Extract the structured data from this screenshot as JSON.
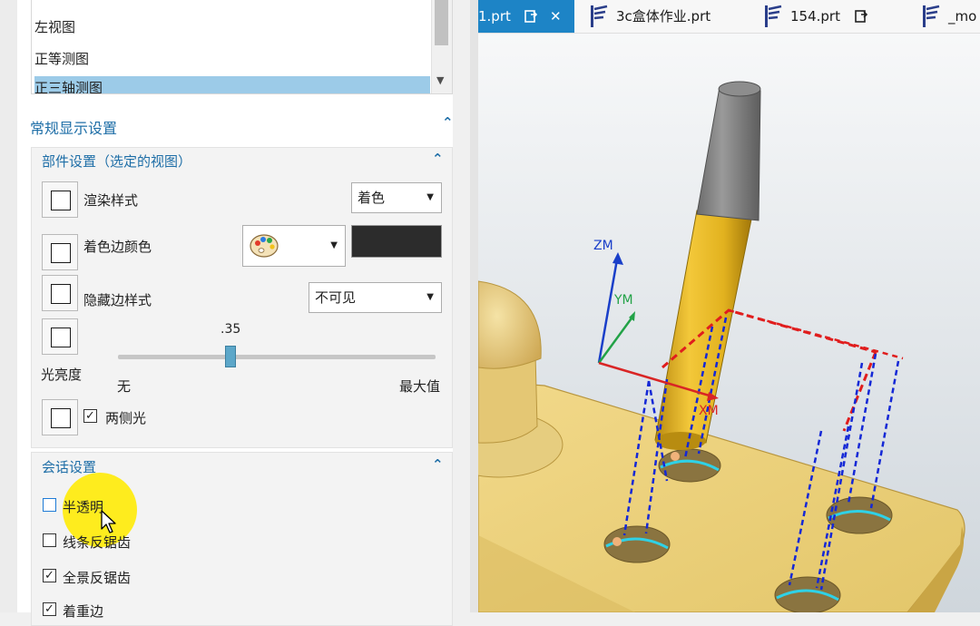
{
  "view_list": {
    "items": [
      "左视图",
      "正等测图",
      "正三轴测图"
    ]
  },
  "general_display": {
    "title": "常规显示设置",
    "part_settings": {
      "title": "部件设置（选定的视图）",
      "render_style": {
        "label": "渲染样式",
        "value": "着色"
      },
      "shaded_edge_color": {
        "label": "着色边颜色",
        "color": "#2c2c2c"
      },
      "hidden_edge_style": {
        "label": "隐藏边样式",
        "value": "不可见"
      },
      "light_brightness": {
        "label": "光亮度",
        "value": ".35",
        "fraction": 0.35,
        "min_label": "无",
        "max_label": "最大值"
      },
      "two_sided_light": {
        "label": "两侧光",
        "checked": true
      }
    },
    "session_settings": {
      "title": "会话设置",
      "options": [
        {
          "label": "半透明",
          "checked": false
        },
        {
          "label": "线条反锯齿",
          "checked": false
        },
        {
          "label": "全景反锯齿",
          "checked": true
        },
        {
          "label": "着重边",
          "checked": true
        }
      ]
    }
  },
  "tabs": [
    {
      "label": "1.prt"
    },
    {
      "label": "3c盒体作业.prt"
    },
    {
      "label": "154.prt"
    },
    {
      "label": "_mo"
    }
  ],
  "axes": {
    "x": "XM",
    "y": "YM",
    "z": "ZM"
  }
}
